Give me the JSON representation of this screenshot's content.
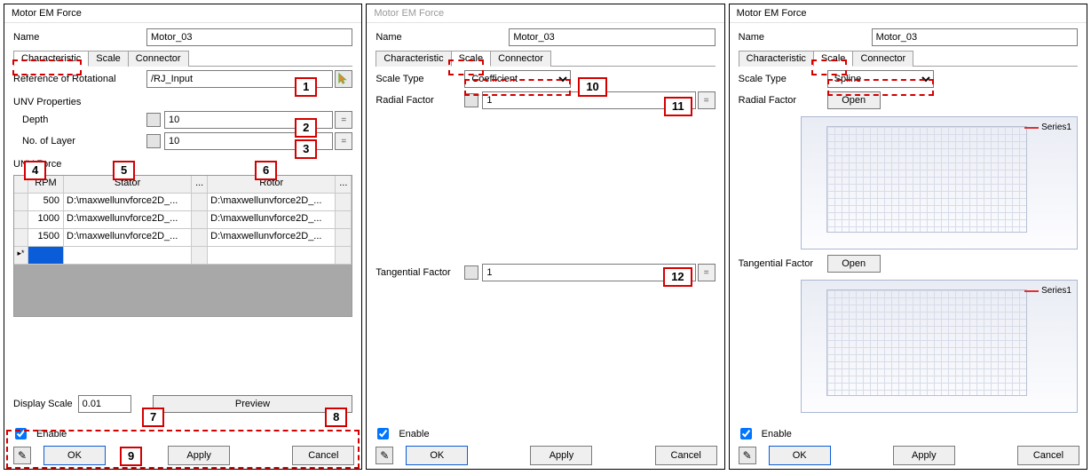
{
  "windowTitle": "Motor EM Force",
  "nameLabel": "Name",
  "nameValue": "Motor_03",
  "tabs": {
    "characteristic": "Characteristic",
    "scale": "Scale",
    "connector": "Connector"
  },
  "refRotLabel": "Reference of Rotational",
  "refRotValue": "/RJ_Input",
  "unvProps": "UNV Properties",
  "depthLabel": "Depth",
  "depthValue": "10",
  "layerLabel": "No. of Layer",
  "layerValue": "10",
  "unvForce": "UNV Force",
  "headers": {
    "rpm": "RPM",
    "stator": "Stator",
    "statorBtn": "...",
    "rotor": "Rotor",
    "rotorBtn": "..."
  },
  "rows": [
    {
      "rpm": "500",
      "st": "D:\\maxwellunvforce2D_...",
      "rt": "D:\\maxwellunvforce2D_..."
    },
    {
      "rpm": "1000",
      "st": "D:\\maxwellunvforce2D_...",
      "rt": "D:\\maxwellunvforce2D_..."
    },
    {
      "rpm": "1500",
      "st": "D:\\maxwellunvforce2D_...",
      "rt": "D:\\maxwellunvforce2D_..."
    }
  ],
  "newRowMarker": "▸*",
  "dispScaleLabel": "Display Scale",
  "dispScaleValue": "0.01",
  "previewBtn": "Preview",
  "enableLabel": "Enable",
  "okBtn": "OK",
  "applyBtn": "Apply",
  "cancelBtn": "Cancel",
  "scaleTypeLabel": "Scale Type",
  "scaleTypeCoeff": "Coefficient",
  "scaleTypeSpline": "Spline",
  "radialLabel": "Radial Factor",
  "radialValue": "1",
  "tangLabel": "Tangential Factor",
  "tangValue": "1",
  "openBtn": "Open",
  "legend": "Series1",
  "eq": "=",
  "badges": {
    "1": "1",
    "2": "2",
    "3": "3",
    "4": "4",
    "5": "5",
    "6": "6",
    "7": "7",
    "8": "8",
    "9": "9",
    "10": "10",
    "11": "11",
    "12": "12"
  }
}
